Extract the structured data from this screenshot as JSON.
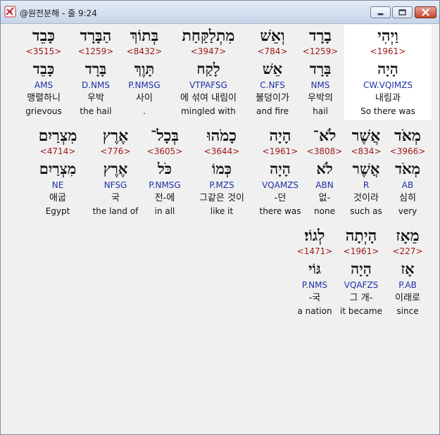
{
  "window": {
    "title": "@원전분해 - 줄 9:24",
    "icons": {
      "app": "bible-app-icon",
      "minimize": "minimize-icon",
      "maximize": "maximize-icon",
      "close": "close-icon"
    }
  },
  "rows": [
    {
      "words": [
        {
          "hebrew": "וַיְהִי",
          "strong": "<1961>",
          "lemma": "הָיָה",
          "morph": "CW.VQIMZS",
          "korean": "내림과",
          "english": "So there was",
          "selected": true
        },
        {
          "hebrew": "בָרָד",
          "strong": "<1259>",
          "lemma": "בָּרָד",
          "morph": "NMS",
          "korean": "우박의",
          "english": "hail"
        },
        {
          "hebrew": "וְאֵשׁ",
          "strong": "<784>",
          "lemma": "אֵשׁ",
          "morph": "C.NFS",
          "korean": "불덩이가",
          "english": "and fire"
        },
        {
          "hebrew": "מִתְלַקַּחַת",
          "strong": "<3947>",
          "lemma": "לָקַח",
          "morph": "VTPAFSG",
          "korean": "에 섞여 내림이",
          "english": "mingled with"
        },
        {
          "hebrew": "בְּתוֹךְ",
          "strong": "<8432>",
          "lemma": "תָּוֶךְ",
          "morph": "P.NMSG",
          "korean": "사이",
          "english": "."
        },
        {
          "hebrew": "הַבָּרָד",
          "strong": "<1259>",
          "lemma": "בָּרָד",
          "morph": "D.NMS",
          "korean": "우박",
          "english": "the hail"
        },
        {
          "hebrew": "כָּבֵד",
          "strong": "<3515>",
          "lemma": "כָּבֵד",
          "morph": "AMS",
          "korean": "맹렬하니",
          "english": "grievous"
        }
      ]
    },
    {
      "words": [
        {
          "hebrew": "מְאֹד",
          "strong": "<3966>",
          "lemma": "מְאֹד",
          "morph": "AB",
          "korean": "심히",
          "english": "very"
        },
        {
          "hebrew": "אֲשֶׁר",
          "strong": "<834>",
          "lemma": "אֲשֶׁר",
          "morph": "R",
          "korean": "것이라",
          "english": "such as"
        },
        {
          "hebrew": "לֹא־",
          "strong": "<3808>",
          "lemma": "לֹא",
          "morph": "ABN",
          "korean": "없-",
          "english": "none"
        },
        {
          "hebrew": "הָיָה",
          "strong": "<1961>",
          "lemma": "הָיָה",
          "morph": "VQAMZS",
          "korean": "-던",
          "english": "there was"
        },
        {
          "hebrew": "כָמֹהוּ",
          "strong": "<3644>",
          "lemma": "כְּמוֹ",
          "morph": "P.MZS",
          "korean": "그같은 것이",
          "english": "like it"
        },
        {
          "hebrew": "בְּכָל־",
          "strong": "<3605>",
          "lemma": "כֹּל",
          "morph": "P.NMSG",
          "korean": "전-에",
          "english": "in all"
        },
        {
          "hebrew": "אֶרֶץ",
          "strong": "<776>",
          "lemma": "אֶרֶץ",
          "morph": "NFSG",
          "korean": "국",
          "english": "the land of"
        },
        {
          "hebrew": "מִצְרַיִם",
          "strong": "<4714>",
          "lemma": "מִצְרַיִם",
          "morph": "NE",
          "korean": "애굽",
          "english": "Egypt"
        }
      ]
    },
    {
      "words": [
        {
          "hebrew": "מֵאָז",
          "strong": "<227>",
          "lemma": "אָז",
          "morph": "P.AB",
          "korean": "이래로",
          "english": "since"
        },
        {
          "hebrew": "הָיְתָה",
          "strong": "<1961>",
          "lemma": "הָיָה",
          "morph": "VQAFZS",
          "korean": "그 개-",
          "english": "it became"
        },
        {
          "hebrew": "לְגוֹי׃",
          "strong": "<1471>",
          "lemma": "גּוֹי",
          "morph": "P.NMS",
          "korean": "-국",
          "english": "a nation"
        }
      ]
    }
  ]
}
